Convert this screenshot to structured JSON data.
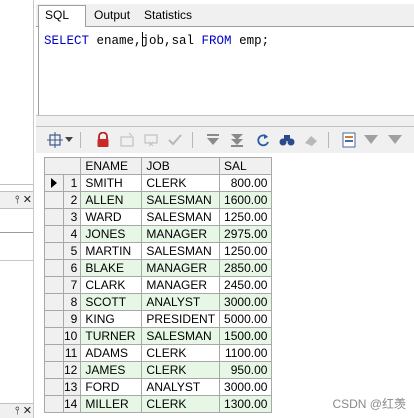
{
  "tabs": [
    {
      "label": "SQL",
      "active": true
    },
    {
      "label": "Output",
      "active": false
    },
    {
      "label": "Statistics",
      "active": false
    }
  ],
  "editor": {
    "tokens": [
      {
        "text": "SELECT",
        "kind": "keyword"
      },
      {
        "text": " ename,",
        "kind": "ident"
      },
      {
        "text": "job,sal ",
        "kind": "ident"
      },
      {
        "text": "FROM",
        "kind": "keyword"
      },
      {
        "text": " emp;",
        "kind": "ident"
      }
    ]
  },
  "side_panel": {
    "pin_close_label": "p ×",
    "pin_close_label_bottom": "p ×"
  },
  "toolbar": {
    "icons": [
      "grid-options-icon",
      "dropdown-arrow-icon",
      "lock-icon",
      "insert-record-icon",
      "delete-record-icon",
      "post-changes-icon",
      "next-page-icon",
      "last-page-icon",
      "refresh-icon",
      "find-icon",
      "clear-icon",
      "export-icon",
      "filter-icon",
      "filter-clear-icon"
    ]
  },
  "grid": {
    "columns": [
      "ENAME",
      "JOB",
      "SAL"
    ],
    "rows": [
      {
        "n": "1",
        "ename": "SMITH",
        "job": "CLERK",
        "sal": "800.00"
      },
      {
        "n": "2",
        "ename": "ALLEN",
        "job": "SALESMAN",
        "sal": "1600.00"
      },
      {
        "n": "3",
        "ename": "WARD",
        "job": "SALESMAN",
        "sal": "1250.00"
      },
      {
        "n": "4",
        "ename": "JONES",
        "job": "MANAGER",
        "sal": "2975.00"
      },
      {
        "n": "5",
        "ename": "MARTIN",
        "job": "SALESMAN",
        "sal": "1250.00"
      },
      {
        "n": "6",
        "ename": "BLAKE",
        "job": "MANAGER",
        "sal": "2850.00"
      },
      {
        "n": "7",
        "ename": "CLARK",
        "job": "MANAGER",
        "sal": "2450.00"
      },
      {
        "n": "8",
        "ename": "SCOTT",
        "job": "ANALYST",
        "sal": "3000.00"
      },
      {
        "n": "9",
        "ename": "KING",
        "job": "PRESIDENT",
        "sal": "5000.00"
      },
      {
        "n": "10",
        "ename": "TURNER",
        "job": "SALESMAN",
        "sal": "1500.00"
      },
      {
        "n": "11",
        "ename": "ADAMS",
        "job": "CLERK",
        "sal": "1100.00"
      },
      {
        "n": "12",
        "ename": "JAMES",
        "job": "CLERK",
        "sal": "950.00"
      },
      {
        "n": "13",
        "ename": "FORD",
        "job": "ANALYST",
        "sal": "3000.00"
      },
      {
        "n": "14",
        "ename": "MILLER",
        "job": "CLERK",
        "sal": "1300.00"
      }
    ],
    "current_row": 1,
    "colors": {
      "alt_row": "#e6f7e6",
      "header": "#f0f0f0",
      "border": "#a8a8a8"
    }
  },
  "watermark": "CSDN @红羡"
}
